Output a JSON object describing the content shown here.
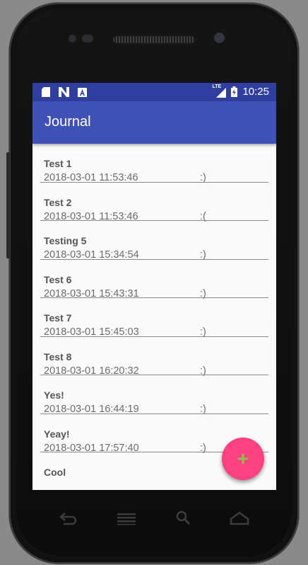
{
  "status_bar": {
    "icons": [
      "sd-card-icon",
      "n-icon",
      "a-icon"
    ],
    "network": "LTE",
    "time": "10:25"
  },
  "app_bar": {
    "title": "Journal"
  },
  "entries": [
    {
      "title": "Test 1",
      "date": "2018-03-01 11:53:46",
      "mood": ":)"
    },
    {
      "title": "Test 2",
      "date": "2018-03-01 11:53:46",
      "mood": ":("
    },
    {
      "title": "Testing 5",
      "date": "2018-03-01 15:34:54",
      "mood": ":)"
    },
    {
      "title": "Test 6",
      "date": "2018-03-01 15:43:31",
      "mood": ":)"
    },
    {
      "title": "Test 7",
      "date": "2018-03-01 15:45:03",
      "mood": ":)"
    },
    {
      "title": "Test 8",
      "date": "2018-03-01 16:20:32",
      "mood": ":)"
    },
    {
      "title": "Yes!",
      "date": "2018-03-01 16:44:19",
      "mood": ":)"
    },
    {
      "title": "Yeay!",
      "date": "2018-03-01 17:57:40",
      "mood": ":)"
    },
    {
      "title": "Cool",
      "date": "",
      "mood": ""
    }
  ],
  "fab": {
    "label": "+",
    "color": "#ff4081",
    "icon_color": "#8bc34a"
  },
  "colors": {
    "primary": "#3f51b5",
    "primary_dark": "#303f9f",
    "accent": "#ff4081"
  },
  "nav": [
    "back-icon",
    "menu-icon",
    "search-icon",
    "home-icon"
  ]
}
